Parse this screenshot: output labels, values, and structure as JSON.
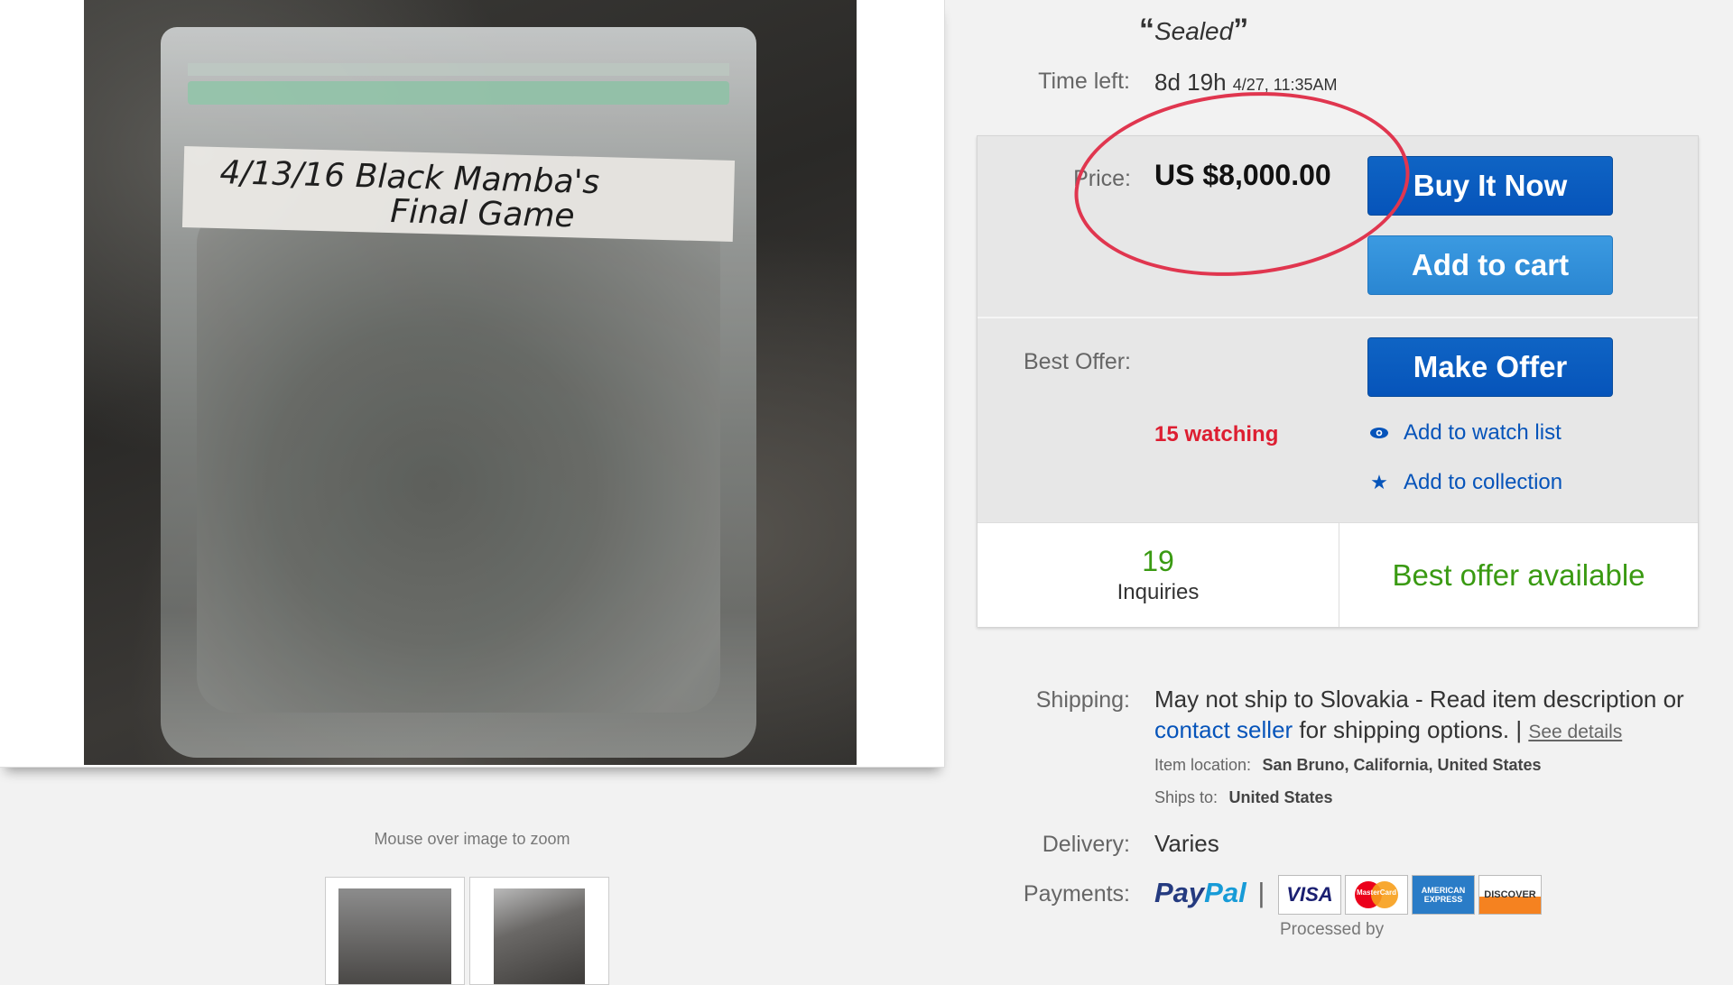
{
  "listing": {
    "condition": "Sealed",
    "time_left_label": "Time left:",
    "time_left_value": "8d 19h",
    "time_left_end": "4/27, 11:35AM",
    "price_label": "Price:",
    "price_value": "US $8,000.00",
    "buy_now_label": "Buy It Now",
    "add_to_cart_label": "Add to cart",
    "best_offer_label": "Best Offer:",
    "make_offer_label": "Make Offer",
    "watching_text": "15 watching",
    "add_watch_label": "Add to watch list",
    "add_collection_label": "Add to collection",
    "inquiries_count": "19",
    "inquiries_label": "Inquiries",
    "best_offer_available": "Best offer available"
  },
  "image": {
    "bag_label_line1": "4/13/16   Black Mamba's",
    "bag_label_line2": "Final  Game",
    "zoom_hint": "Mouse over image to zoom"
  },
  "shipping": {
    "label": "Shipping:",
    "text_a": "May not ship to Slovakia - Read item description or ",
    "contact_link": "contact seller",
    "text_b": " for shipping options. | ",
    "see_details": "See details",
    "item_location_label": "Item location:",
    "item_location_value": "San Bruno, California, United States",
    "ships_to_label": "Ships to:",
    "ships_to_value": "United States"
  },
  "delivery": {
    "label": "Delivery:",
    "value": "Varies"
  },
  "payments": {
    "label": "Payments:",
    "paypal_a": "Pay",
    "paypal_b": "Pal",
    "separator": "|",
    "cards": [
      "VISA",
      "MasterCard",
      "AMERICAN EXPRESS",
      "DISCOVER"
    ],
    "processed_by": "Processed by"
  },
  "colors": {
    "primary_button": "#0654ba",
    "secondary_button": "#2a86d2",
    "watching_red": "#dd1e31",
    "offer_green": "#3a9a12",
    "annotation_circle": "#e0364f"
  },
  "icons": {
    "watch": "eye-icon",
    "collection": "star-icon"
  }
}
